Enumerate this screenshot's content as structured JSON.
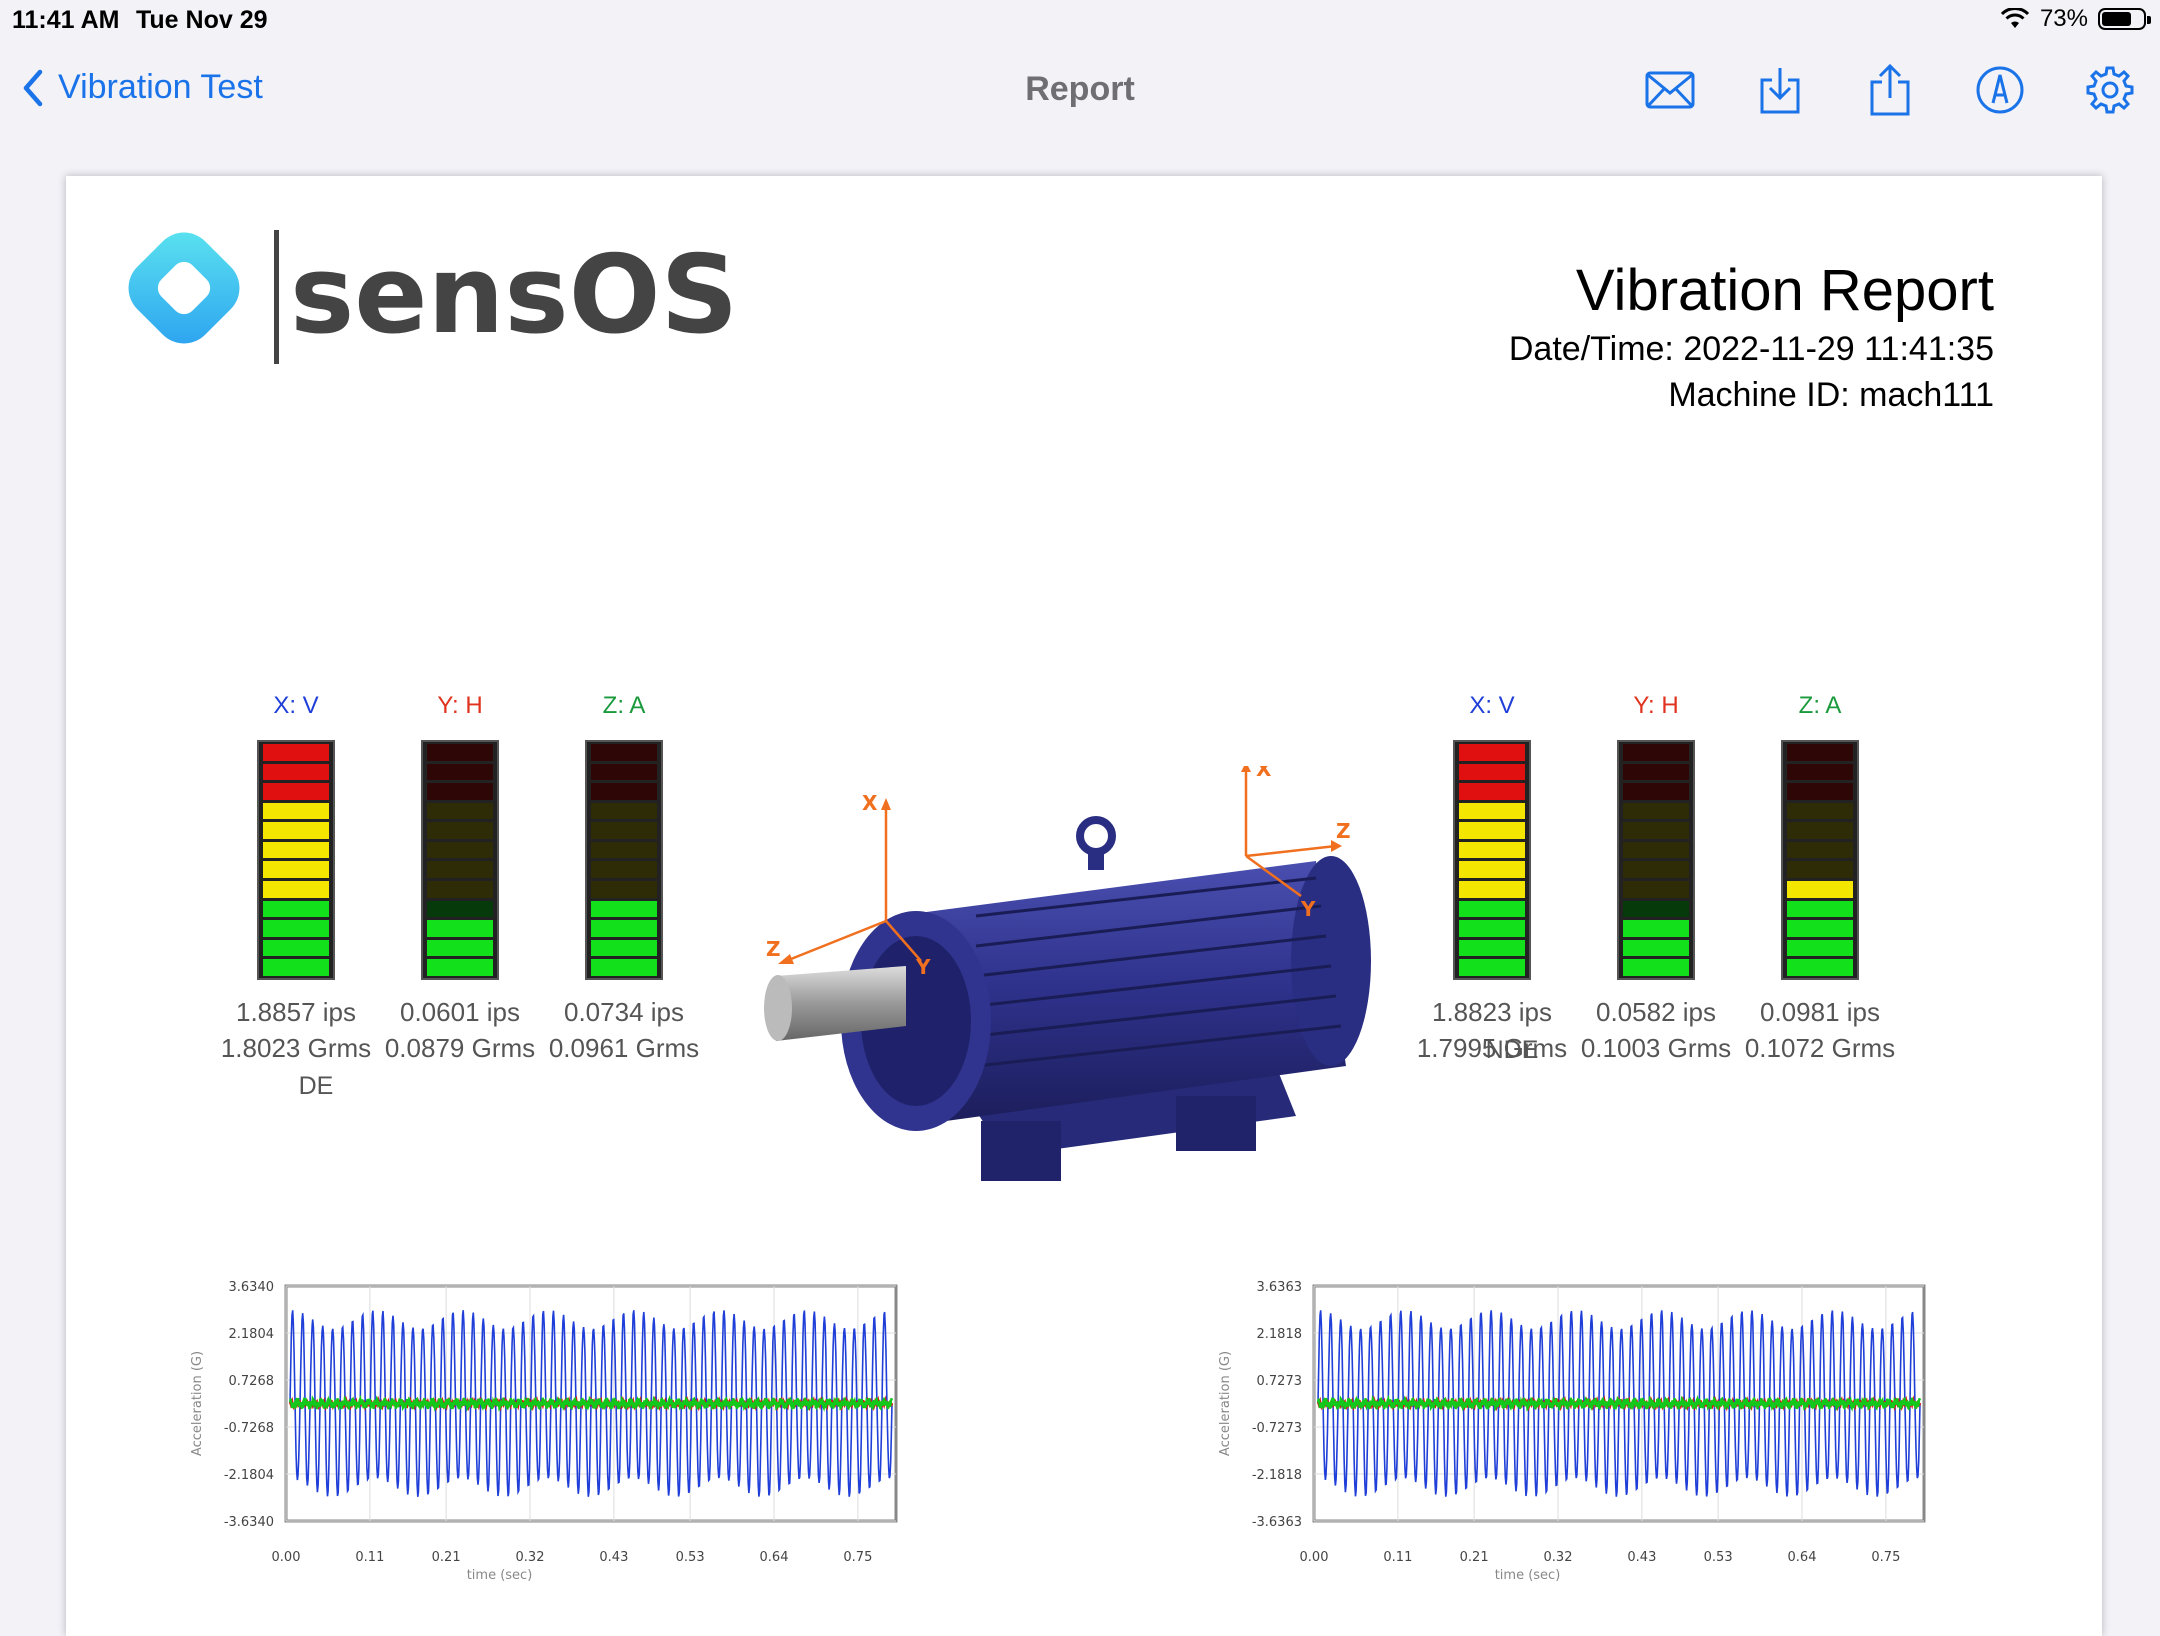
{
  "status": {
    "time": "11:41 AM",
    "date": "Tue Nov 29",
    "battery": "73%",
    "battery_level": 0.73
  },
  "nav": {
    "back_label": "Vibration Test",
    "title": "Report",
    "icons": [
      "mail-icon",
      "download-icon",
      "share-icon",
      "markup-icon",
      "settings-icon"
    ]
  },
  "report": {
    "logo_text": "sensOS",
    "title": "Vibration Report",
    "datetime": "Date/Time: 2022-11-29 11:41:35",
    "machine": "Machine ID: mach111"
  },
  "colors": {
    "accent": "#1a73e8",
    "x_axis": "#1f3fd8",
    "y_axis": "#e0321e",
    "z_axis": "#1a9a3c",
    "red": "#e01010",
    "yellow": "#f5e600",
    "green": "#12e01a"
  },
  "groups": [
    {
      "label": "DE",
      "meters": [
        {
          "axis": "X: V",
          "ips": "1.8857 ips",
          "grms": "1.8023 Grms",
          "lit": 12
        },
        {
          "axis": "Y: H",
          "ips": "0.0601 ips",
          "grms": "0.0879 Grms",
          "lit": 3
        },
        {
          "axis": "Z: A",
          "ips": "0.0734 ips",
          "grms": "0.0961 Grms",
          "lit": 4
        }
      ]
    },
    {
      "label": "NDE",
      "meters": [
        {
          "axis": "X: V",
          "ips": "1.8823 ips",
          "grms": "1.7995 Grms",
          "lit": 12
        },
        {
          "axis": "Y: H",
          "ips": "0.0582 ips",
          "grms": "0.1003 Grms",
          "lit": 3
        },
        {
          "axis": "Z: A",
          "ips": "0.0981 ips",
          "grms": "0.1072 Grms",
          "lit": 5
        }
      ]
    }
  ],
  "motor_axes": [
    "X",
    "Y",
    "Z",
    "X",
    "Y",
    "Z"
  ],
  "chart_data": [
    {
      "type": "line",
      "ylabel": "Acceleration (G)",
      "xlabel": "time (sec)",
      "yticks": [
        "3.6340",
        "2.1804",
        "0.7268",
        "-0.7268",
        "-2.1804",
        "-3.6340"
      ],
      "xticks": [
        "0.00",
        "0.11",
        "0.21",
        "0.32",
        "0.43",
        "0.53",
        "0.64",
        "0.75"
      ],
      "ylim": [
        -3.634,
        3.634
      ],
      "xlim": [
        0,
        0.8
      ],
      "series": [
        {
          "color": "#1f3fd8",
          "amplitude": 2.9,
          "cycles": 60
        },
        {
          "color": "#e01010",
          "amplitude": 0.12
        },
        {
          "color": "#12c81a",
          "amplitude": 0.18
        }
      ]
    },
    {
      "type": "line",
      "ylabel": "Acceleration (G)",
      "xlabel": "time (sec)",
      "yticks": [
        "3.6363",
        "2.1818",
        "0.7273",
        "-0.7273",
        "-2.1818",
        "-3.6363"
      ],
      "xticks": [
        "0.00",
        "0.11",
        "0.21",
        "0.32",
        "0.43",
        "0.53",
        "0.64",
        "0.75"
      ],
      "ylim": [
        -3.6363,
        3.6363
      ],
      "xlim": [
        0,
        0.8
      ],
      "series": [
        {
          "color": "#1f3fd8",
          "amplitude": 2.9,
          "cycles": 60
        },
        {
          "color": "#e01010",
          "amplitude": 0.12
        },
        {
          "color": "#12c81a",
          "amplitude": 0.18
        }
      ]
    }
  ]
}
